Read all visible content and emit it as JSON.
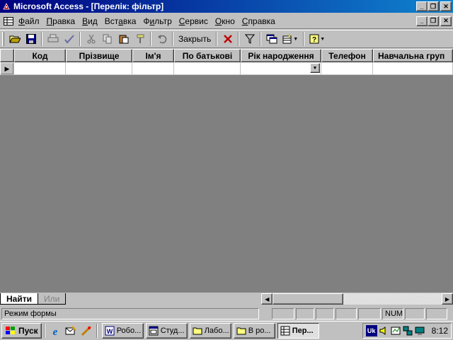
{
  "window": {
    "title": "Microsoft Access - [Перелік: фільтр]",
    "caption_buttons": [
      "_",
      "❐",
      "✕"
    ]
  },
  "menu": {
    "items": [
      {
        "u": "Ф",
        "rest": "айл"
      },
      {
        "u": "П",
        "rest": "равка"
      },
      {
        "u": "В",
        "rest": "ид"
      },
      {
        "pre": "Вст",
        "u": "а",
        "rest": "вка"
      },
      {
        "pre": "Ф",
        "u": "и",
        "rest": "льтр"
      },
      {
        "u": "С",
        "rest": "ервис"
      },
      {
        "u": "О",
        "rest": "кно"
      },
      {
        "u": "С",
        "rest": "правка"
      }
    ]
  },
  "toolbar": {
    "close_label": "Закрыть"
  },
  "grid": {
    "columns": [
      "Код",
      "Прізвище",
      "Ім'я",
      "По батькові",
      "Рік народження",
      "Телефон",
      "Навчальна груп"
    ],
    "row_selector": "▶",
    "combo_arrow": "▼"
  },
  "tabs": {
    "find": "Найти",
    "or": "Или"
  },
  "scrollbar": {
    "left_arrow": "◀",
    "right_arrow": "▶"
  },
  "status": {
    "mode_text": "Режим формы",
    "num_indicator": "NUM"
  },
  "taskbar": {
    "start_label": "Пуск",
    "tasks": [
      "Робо...",
      "Студ...",
      "Лабо...",
      "В ро...",
      "Пер..."
    ],
    "tray_lang": "Uk",
    "clock": "8:12"
  }
}
